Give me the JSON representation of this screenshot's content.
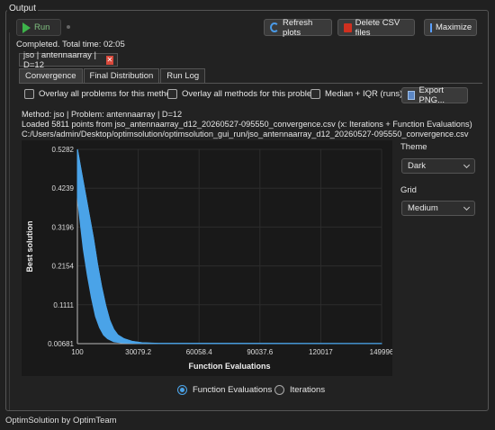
{
  "output": {
    "group_title": "Output"
  },
  "toolbar": {
    "run_label": "Run",
    "refresh_label": "Refresh plots",
    "delete_label": "Delete CSV files",
    "maximize_label": "Maximize"
  },
  "status": "Completed. Total time: 02:05",
  "run_tab": {
    "label": "jso | antennaarray | D=12",
    "close_symbol": "✕"
  },
  "tabs": [
    "Convergence",
    "Final Distribution",
    "Run Log"
  ],
  "options": {
    "overlay_problems": "Overlay all problems for this method",
    "overlay_methods": "Overlay all methods for this problem",
    "median_iqr": "Median + IQR (runs)",
    "export_label": "Export PNG..."
  },
  "info": {
    "line1": "Method: jso | Problem: antennaarray | D=12",
    "line2": "Loaded 5811 points from jso_antennaarray_d12_20260527-095550_convergence.csv (x: Iterations + Function Evaluations)",
    "line3": "C:/Users/admin/Desktop/optimsolution/optimsolution_gui_run/jso_antennaarray_d12_20260527-095550_convergence.csv"
  },
  "side": {
    "theme_label": "Theme",
    "theme_value": "Dark",
    "grid_label": "Grid",
    "grid_value": "Medium"
  },
  "x_axis_mode": {
    "selected": "Function Evaluations",
    "option1": "Function Evaluations",
    "option2": "Iterations"
  },
  "footer": "OptimSolution by OptimTeam",
  "colors": {
    "series": "#4aa3e8",
    "accent_run": "#3db34a",
    "delete": "#d0301f"
  },
  "chart_data": {
    "type": "line",
    "xlabel": "Function Evaluations",
    "ylabel": "Best solution",
    "x_ticks": [
      "100",
      "30079.2",
      "60058.4",
      "90037.6",
      "120017",
      "149996"
    ],
    "y_ticks": [
      "0.5282",
      "0.4239",
      "0.3196",
      "0.2154",
      "0.1111",
      "0.00681"
    ],
    "xlim": [
      100,
      149996
    ],
    "ylim": [
      0.00681,
      0.5282
    ],
    "grid": true,
    "series": [
      {
        "upper": [
          [
            100,
            0.5282
          ],
          [
            2000,
            0.47
          ],
          [
            4000,
            0.41
          ],
          [
            6000,
            0.35
          ],
          [
            8000,
            0.29
          ],
          [
            10000,
            0.22
          ],
          [
            12000,
            0.16
          ],
          [
            14000,
            0.11
          ],
          [
            16000,
            0.07
          ],
          [
            18000,
            0.045
          ],
          [
            20000,
            0.03
          ],
          [
            23000,
            0.02
          ],
          [
            27000,
            0.013
          ],
          [
            32000,
            0.009
          ],
          [
            40000,
            0.0075
          ],
          [
            149996,
            0.0072
          ]
        ],
        "lower": [
          [
            100,
            0.4
          ],
          [
            1500,
            0.33
          ],
          [
            3000,
            0.26
          ],
          [
            5000,
            0.19
          ],
          [
            7000,
            0.13
          ],
          [
            9000,
            0.08
          ],
          [
            11000,
            0.05
          ],
          [
            13000,
            0.03
          ],
          [
            15000,
            0.02
          ],
          [
            18000,
            0.012
          ],
          [
            22000,
            0.009
          ],
          [
            30000,
            0.0075
          ],
          [
            149996,
            0.00681
          ]
        ]
      }
    ]
  }
}
